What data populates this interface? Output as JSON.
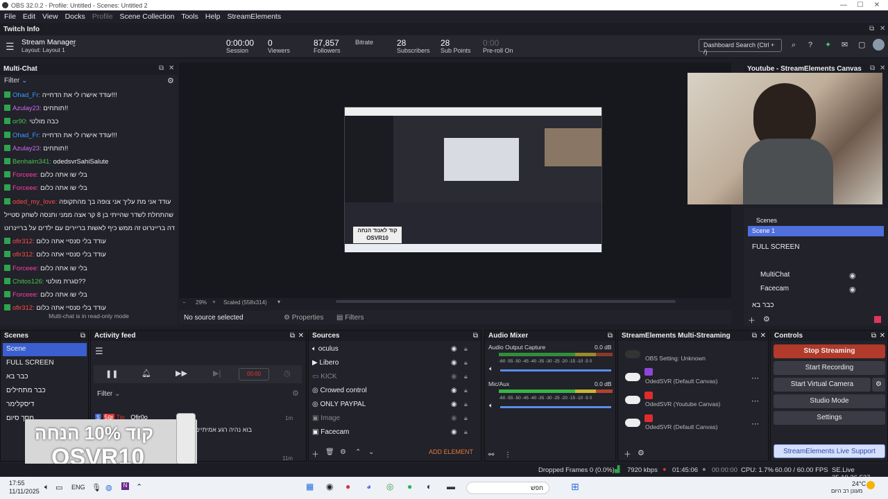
{
  "window": {
    "title": "OBS 32.0.2 - Profile: Untitled - Scenes: Untitled 2",
    "minimize": "—",
    "maximize": "☐",
    "close": "✕"
  },
  "menu": [
    "File",
    "Edit",
    "View",
    "Docks",
    "Profile",
    "Scene Collection",
    "Tools",
    "Help",
    "StreamElements"
  ],
  "twitch_info": {
    "title": "Twitch Info"
  },
  "stream_manager": {
    "title": "Stream Manager",
    "layout": "Layout: Layout 1"
  },
  "stats": [
    {
      "value": "0:00:00",
      "label": "Session"
    },
    {
      "value": "0",
      "label": "Viewers"
    },
    {
      "value": "87,857",
      "label": "Followers"
    },
    {
      "value": "",
      "label": "Bitrate"
    },
    {
      "value": "28",
      "label": "Subscribers"
    },
    {
      "value": "28",
      "label": "Sub Points"
    },
    {
      "value": "0:00",
      "label": "Pre-roll On"
    }
  ],
  "search": {
    "placeholder": "Dashboard Search (Ctrl + /)"
  },
  "multichat": {
    "title": "Multi-Chat",
    "filter": "Filter",
    "footer": "Multi-chat is in read-only mode",
    "messages": [
      {
        "user": "Ohad_Fr:",
        "color": "#3f9bff",
        "text": "עודד אישרו לי את הדחייה!!!"
      },
      {
        "user": "Azulay23:",
        "color": "#d36af0",
        "text": "תותחים!!"
      },
      {
        "user": "or90:",
        "color": "#4cc24c",
        "text": "כבה מולטי"
      },
      {
        "user": "Ohad_Fr:",
        "color": "#3f9bff",
        "text": "עודד אישרו לי את הדחייה!!!"
      },
      {
        "user": "Azulay23:",
        "color": "#d36af0",
        "text": "תותחים!!"
      },
      {
        "user": "Benhaim341:",
        "color": "#4cc24c",
        "text": "odedsvrSahiSalute"
      },
      {
        "user": "Forceee:",
        "color": "#ff3fa8",
        "text": "בלי שו אתה כלום"
      },
      {
        "user": "Forceee:",
        "color": "#ff3fa8",
        "text": "בלי שו אתה כלום"
      },
      {
        "user": "oded_my_love:",
        "color": "#ff4b4b",
        "text": "עודד אני מת עליך אני צופה בך מהתקופה"
      },
      {
        "user": "",
        "color": "#eee",
        "text": "שהתחלת לשדר שהייתי בן 8 קר אצה ממני ותנסה לשחק סטייל"
      },
      {
        "user": "",
        "color": "#eee",
        "text": "דה בריינרוט זה ממש כיף לאשות בריירים עם ילדים על בריינרוט"
      },
      {
        "user": "ofir312:",
        "color": "#ff4b4b",
        "text": "עודד בלי סנסיי אתה כלום"
      },
      {
        "user": "ofir312:",
        "color": "#ff4b4b",
        "text": "עודד בלי סנסיי אתה כלום"
      },
      {
        "user": "Forceee:",
        "color": "#ff3fa8",
        "text": "בלי שו אתה כלום"
      },
      {
        "user": "Chitos126:",
        "color": "#4cc24c",
        "text": "סגרת מולטי??"
      },
      {
        "user": "Forceee:",
        "color": "#ff3fa8",
        "text": "בלי שו אתה כלום"
      },
      {
        "user": "ofir312:",
        "color": "#ff4b4b",
        "text": "עודד בלי סנסיי אתה כלום"
      }
    ]
  },
  "preview": {
    "zoom": "29%",
    "scaled": "Scaled (558x314)",
    "no_source": "No source selected",
    "properties": "Properties",
    "filters": "Filters",
    "overlay_text": "קוד לאנוד הנחה OSVR10"
  },
  "youtube_canvas": {
    "title": "Youtube - StreamElements Canvas",
    "scenes_label": "Scenes",
    "scene1": "Scene 1",
    "items": [
      "FULL SCREEN",
      "MultiChat",
      "Facecam",
      "כבר בא"
    ]
  },
  "scenes": {
    "title": "Scenes",
    "items": [
      "Scene",
      "FULL SCREEN",
      "כבר בא",
      "כבר מתחילים",
      "דיסקלימר",
      "מסך סיום"
    ]
  },
  "activity": {
    "title": "Activity feed",
    "filter": "Filter",
    "timer": "00:00",
    "user": "Ofir0o",
    "event": "Tip",
    "amount": "5₪",
    "msg": "בוא נהיה רגע אמיתיים",
    "t1": "1m",
    "t2": "11m"
  },
  "sources": {
    "title": "Sources",
    "items": [
      "oculus",
      "Libero",
      "KICK",
      "Crowed control",
      "ONLY PAYPAL",
      "Image",
      "Facecam"
    ],
    "add": "ADD ELEMENT"
  },
  "audio": {
    "title": "Audio Mixer",
    "channels": [
      {
        "name": "Audio Output Capture",
        "db": "0.0 dB"
      },
      {
        "name": "Mic/Aux",
        "db": "0.0 dB"
      }
    ],
    "scale": "-60 -55 -50 -45 -40 -35 -30 -25 -20 -15 -10 -5 0"
  },
  "multistream": {
    "title": "StreamElements Multi-Streaming",
    "rows": [
      "OBS Setting: Unknown",
      "OdedSVR (Default Canvas)",
      "OdedSVR (Youtube Canvas)",
      "OdedSVR (Default Canvas)"
    ]
  },
  "controls": {
    "title": "Controls",
    "stop": "Stop Streaming",
    "record": "Start Recording",
    "virtual": "Start Virtual Camera",
    "studio": "Studio Mode",
    "settings": "Settings",
    "support": "StreamElements Live Support"
  },
  "status": {
    "dropped": "Dropped Frames 0 (0.0%)",
    "kbps": "7920 kbps",
    "time1": "01:45:06",
    "time2": "00:00:00",
    "cpu": "CPU: 1.7%",
    "fps": "60.00 / 60.00 FPS",
    "version": "SE.Live 25.10.26.527"
  },
  "promo": {
    "line1": "קוד 10% הנחה",
    "line2": "OSVR10"
  },
  "taskbar": {
    "time": "17:55",
    "date": "11/11/2025",
    "lang": "ENG",
    "search": "חפש",
    "temp": "24°C",
    "weather": "מעונן רב היום"
  },
  "colors": {
    "stop": "#c0392b",
    "accent": "#2a6fdb",
    "green": "#2ea44f"
  }
}
